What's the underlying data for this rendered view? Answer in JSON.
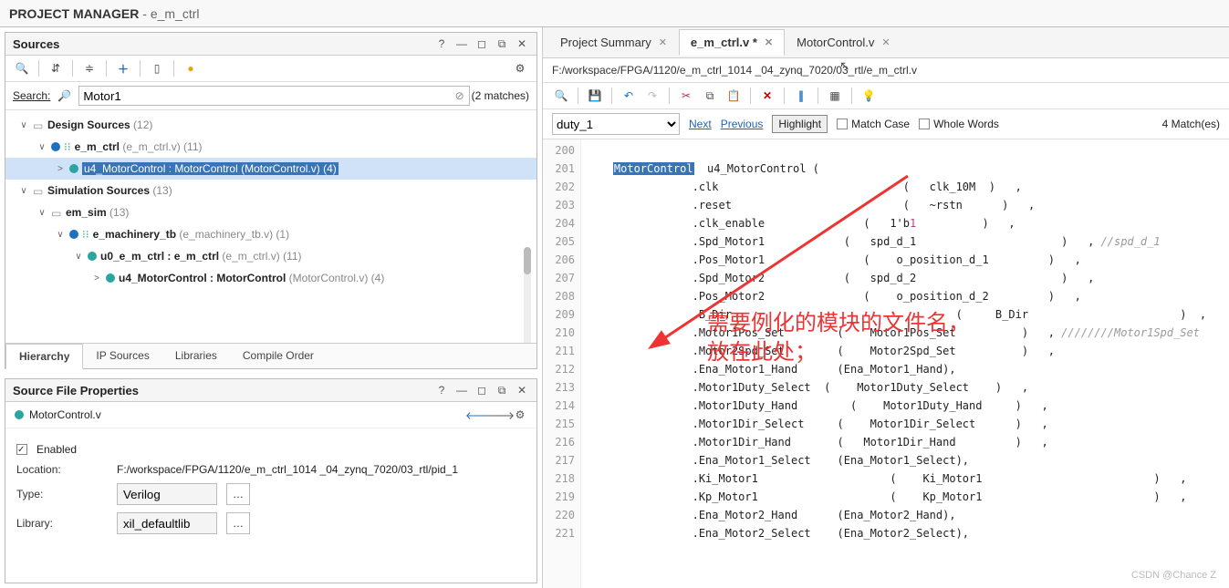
{
  "header": {
    "title": "PROJECT MANAGER",
    "project": "e_m_ctrl"
  },
  "sources": {
    "panel_title": "Sources",
    "search_label": "Search:",
    "search_value": "Motor1",
    "match_text": "(2 matches)",
    "gear": "⚙",
    "tree": [
      {
        "indent": 0,
        "twisty": "∨",
        "kind": "folder",
        "text": "Design Sources",
        "suffix": "(12)"
      },
      {
        "indent": 1,
        "twisty": "∨",
        "kind": "blue",
        "pre": "⁝⁝",
        "text": "e_m_ctrl",
        "suffix": "(e_m_ctrl.v) (11)"
      },
      {
        "indent": 2,
        "twisty": ">",
        "kind": "teal",
        "text": "u4_MotorControl : MotorControl",
        "suffix": "(MotorControl.v) (4)",
        "selected": true,
        "selwrap": true
      },
      {
        "indent": 0,
        "twisty": "∨",
        "kind": "folder",
        "text": "Simulation Sources",
        "suffix": "(13)"
      },
      {
        "indent": 1,
        "twisty": "∨",
        "kind": "folder",
        "text": "em_sim",
        "suffix": "(13)"
      },
      {
        "indent": 2,
        "twisty": "∨",
        "kind": "blue",
        "pre": "⁝⁝",
        "text": "e_machinery_tb",
        "suffix": "(e_machinery_tb.v) (1)"
      },
      {
        "indent": 3,
        "twisty": "∨",
        "kind": "teal",
        "text": "u0_e_m_ctrl : e_m_ctrl",
        "suffix": "(e_m_ctrl.v) (11)"
      },
      {
        "indent": 4,
        "twisty": ">",
        "kind": "teal",
        "text": "u4_MotorControl : MotorControl",
        "suffix": "(MotorControl.v) (4)"
      }
    ],
    "bottom_tabs": [
      "Hierarchy",
      "IP Sources",
      "Libraries",
      "Compile Order"
    ],
    "active_bottom_tab": 0
  },
  "props": {
    "panel_title": "Source File Properties",
    "file": "MotorControl.v",
    "enabled_label": "Enabled",
    "rows": {
      "location_label": "Location:",
      "location_value": "F:/workspace/FPGA/1120/e_m_ctrl_1014 _04_zynq_7020/03_rtl/pid_1",
      "type_label": "Type:",
      "type_value": "Verilog",
      "library_label": "Library:",
      "library_value": "xil_defaultlib"
    }
  },
  "editor": {
    "tabs": [
      {
        "label": "Project Summary",
        "closable": true
      },
      {
        "label": "e_m_ctrl.v *",
        "closable": true,
        "active": true
      },
      {
        "label": "MotorControl.v",
        "closable": true
      }
    ],
    "path": "F:/workspace/FPGA/1120/e_m_ctrl_1014 _04_zynq_7020/03_rtl/e_m_ctrl.v",
    "find": {
      "term": "duty_1",
      "next": "Next",
      "prev": "Previous",
      "highlight": "Highlight",
      "match_case": "Match Case",
      "whole_words": "Whole Words",
      "count": "4 Match(es)"
    },
    "first_line_no": 200,
    "lines": [
      "",
      "    [[MotorControl]]  u4_MotorControl (",
      "                .clk                            (   clk_10M  )   ,",
      "                .reset                          (   ~rstn      )   ,",
      "                .clk_enable               (   1'b{{1}}          )   ,",
      "                .Spd_Motor1            (   spd_d_1                      )   , //spd_d_1",
      "                .Pos_Motor1               (    o_position_d_1         )   ,",
      "                .Spd_Motor2            (   spd_d_2                      )   ,",
      "                .Pos_Motor2               (    o_position_d_2         )   ,",
      "                .B_Dir                                  (     B_Dir                       )  ,",
      "                .Motor1Pos_Set        (    Motor1Pos_Set          )   , ////////Motor1Spd_Set",
      "                .Motor2Spd_Set        (    Motor2Spd_Set          )   ,",
      "                .Ena_Motor1_Hand      (Ena_Motor1_Hand),",
      "                .Motor1Duty_Select  (    Motor1Duty_Select    )   ,",
      "                .Motor1Duty_Hand        (    Motor1Duty_Hand     )   ,",
      "                .Motor1Dir_Select     (    Motor1Dir_Select      )   ,",
      "                .Motor1Dir_Hand       (   Motor1Dir_Hand         )   ,",
      "                .Ena_Motor1_Select    (Ena_Motor1_Select),",
      "                .Ki_Motor1                    (    Ki_Motor1                          )   ,",
      "                .Kp_Motor1                    (    Kp_Motor1                          )   ,",
      "                .Ena_Motor2_Hand      (Ena_Motor2_Hand),",
      "                .Ena_Motor2_Select    (Ena_Motor2_Select),"
    ]
  },
  "annotation": {
    "line1": "需要例化的模块的文件名，",
    "line2": "放在此处；"
  },
  "watermark": "CSDN @Chance Z"
}
